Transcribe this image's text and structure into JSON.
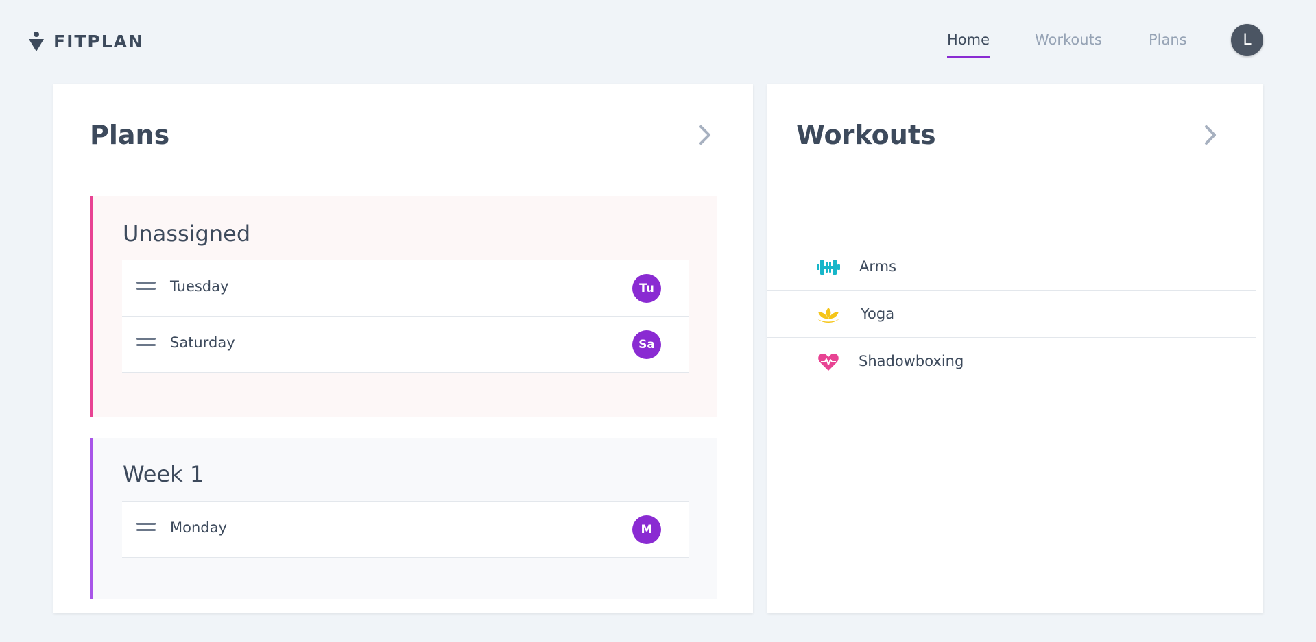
{
  "brand": {
    "name": "FITPLAN",
    "icon": "person-icon"
  },
  "nav": {
    "links": [
      {
        "label": "Home",
        "active": true
      },
      {
        "label": "Workouts",
        "active": false
      },
      {
        "label": "Plans",
        "active": false
      }
    ],
    "avatar_initial": "L"
  },
  "plans": {
    "title": "Plans",
    "groups": [
      {
        "name": "Unassigned",
        "accent": "#e84393",
        "days": [
          {
            "label": "Tuesday",
            "badge": "Tu"
          },
          {
            "label": "Saturday",
            "badge": "Sa"
          }
        ]
      },
      {
        "name": "Week 1",
        "accent": "#a855e8",
        "days": [
          {
            "label": "Monday",
            "badge": "M"
          }
        ]
      }
    ]
  },
  "workouts": {
    "title": "Workouts",
    "items": [
      {
        "label": "Arms",
        "icon": "dumbbell-icon",
        "color": "#17b6c9"
      },
      {
        "label": "Yoga",
        "icon": "lotus-icon",
        "color": "#f5c518"
      },
      {
        "label": "Shadowboxing",
        "icon": "heartbeat-icon",
        "color": "#e84393"
      }
    ]
  },
  "colors": {
    "accent": "#8a2bd2",
    "background": "#f0f4f8",
    "text": "#3d4a5c"
  }
}
